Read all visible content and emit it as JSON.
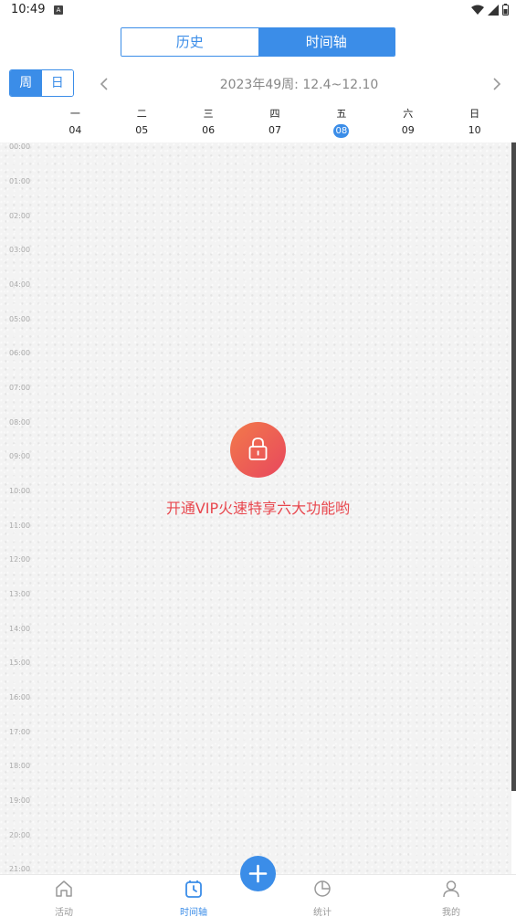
{
  "status": {
    "time": "10:49",
    "notif_badge": "A"
  },
  "header": {
    "tabs": [
      {
        "label": "历史",
        "active": false
      },
      {
        "label": "时间轴",
        "active": true
      }
    ]
  },
  "mode": {
    "week": "周",
    "day": "日",
    "selected": "周"
  },
  "week_nav": {
    "title": "2023年49周: 12.4~12.10"
  },
  "days": [
    {
      "name": "一",
      "num": "04"
    },
    {
      "name": "二",
      "num": "05"
    },
    {
      "name": "三",
      "num": "06"
    },
    {
      "name": "四",
      "num": "07"
    },
    {
      "name": "五",
      "num": "08",
      "today": true
    },
    {
      "name": "六",
      "num": "09"
    },
    {
      "name": "日",
      "num": "10"
    }
  ],
  "hours": [
    "00:00",
    "01:00",
    "02:00",
    "03:00",
    "04:00",
    "05:00",
    "06:00",
    "07:00",
    "08:00",
    "09:00",
    "10:00",
    "11:00",
    "12:00",
    "13:00",
    "14:00",
    "15:00",
    "16:00",
    "17:00",
    "18:00",
    "19:00",
    "20:00",
    "21:00"
  ],
  "lock": {
    "message": "开通VIP火速特享六大功能哟"
  },
  "tabbar": {
    "items": [
      {
        "label": "活动"
      },
      {
        "label": "时间轴",
        "active": true
      },
      {
        "label": "统计"
      },
      {
        "label": "我的"
      }
    ]
  },
  "colors": {
    "accent": "#3b8de8",
    "lock_gradient_start": "#f27a4a",
    "lock_gradient_end": "#e8475e",
    "lock_text": "#e8474e"
  }
}
